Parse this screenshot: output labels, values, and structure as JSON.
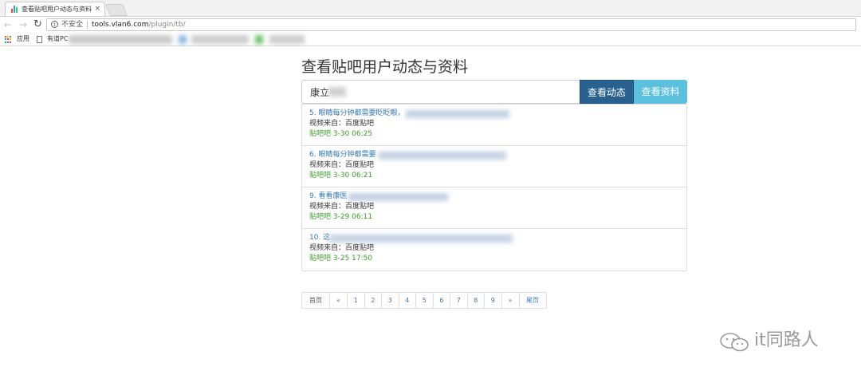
{
  "browser": {
    "tab_title": "查看贴吧用户动态与资料",
    "tab_close": "×",
    "insecure_label": "不安全",
    "url_host": "tools.vlan6.com",
    "url_path": "/plugin/tb/",
    "bookmarks": [
      "应用",
      "有道PC"
    ]
  },
  "page": {
    "title": "查看贴吧用户动态与资料",
    "search_value": "康立",
    "feed_button": "查看动态",
    "profile_button": "查看资料"
  },
  "items": [
    {
      "title": "5. 眼睛每分钟都需要眨眨眼，",
      "source": "视频来自：百度贴吧",
      "meta": "贴吧吧 3-30 06:25"
    },
    {
      "title": "6. 眼睛每分钟都需要",
      "source": "视频来自：百度贴吧",
      "meta": "贴吧吧 3-30 06:21"
    },
    {
      "title": "9. 看看康医",
      "source": "视频来自：百度贴吧",
      "meta": "贴吧吧 3-29 06:11"
    },
    {
      "title": "10. 这",
      "source": "视频来自：百度贴吧",
      "meta": "贴吧吧 3-25 17:50"
    }
  ],
  "pagination": {
    "first": "首页",
    "prev": "«",
    "pages": [
      "1",
      "2",
      "3",
      "4",
      "5",
      "6",
      "7",
      "8",
      "9"
    ],
    "next": "»",
    "last": "尾页"
  },
  "watermark": "it同路人",
  "colors": {
    "primary_button": "#286090",
    "info_button": "#5bc0de",
    "link": "#337ab7",
    "meta_green": "#3c9a28"
  }
}
